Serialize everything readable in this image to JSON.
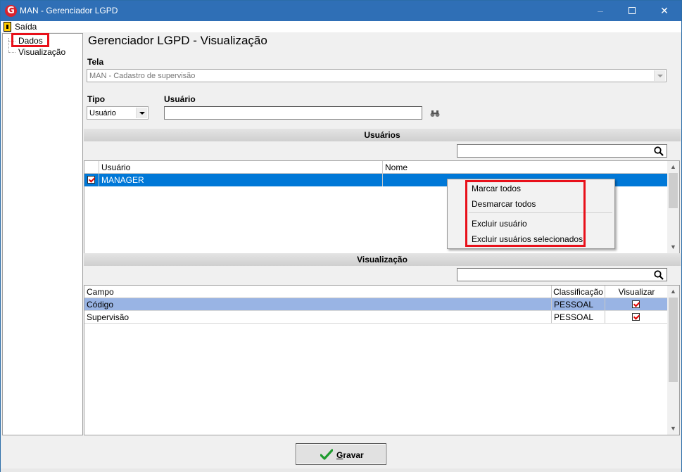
{
  "window": {
    "title": "MAN - Gerenciador LGPD",
    "minimize_icon": "minimize-icon",
    "maximize_icon": "maximize-icon",
    "close_icon": "close-icon"
  },
  "menu": {
    "exit_label": "Saída"
  },
  "sidebar": {
    "items": [
      {
        "label": "Dados"
      },
      {
        "label": "Visualização"
      }
    ]
  },
  "form": {
    "title": "Gerenciador LGPD - Visualização",
    "tela_label": "Tela",
    "tela_value": "MAN - Cadastro de supervisão",
    "tipo_label": "Tipo",
    "tipo_value": "Usuário",
    "usuario_label": "Usuário",
    "usuario_value": ""
  },
  "users_section": {
    "header": "Usuários",
    "search_value": "",
    "columns": [
      "Usuário",
      "Nome"
    ],
    "rows": [
      {
        "checked": true,
        "usuario": "MANAGER",
        "nome": ""
      }
    ]
  },
  "context_menu": {
    "items": [
      "Marcar todos",
      "Desmarcar todos",
      "Excluir usuário",
      "Excluir usuários selecionados"
    ]
  },
  "view_section": {
    "header": "Visualização",
    "search_value": "",
    "columns": [
      "Campo",
      "Classificação",
      "Visualizar"
    ],
    "rows": [
      {
        "campo": "Código",
        "classificacao": "PESSOAL",
        "visualizar": true
      },
      {
        "campo": "Supervisão",
        "classificacao": "PESSOAL",
        "visualizar": true
      }
    ]
  },
  "actions": {
    "save_label_underlined": "G",
    "save_label_rest": "ravar"
  },
  "colors": {
    "titlebar": "#2f6fb6",
    "selection": "#0078d7",
    "row_highlight": "#99b4e4",
    "annotation": "#e8101a",
    "check_mark": "#e00000"
  }
}
